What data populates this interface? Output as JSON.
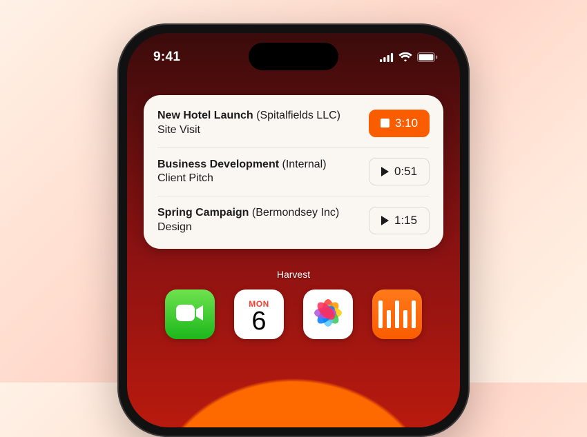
{
  "status": {
    "time": "9:41"
  },
  "widget": {
    "label": "Harvest",
    "entries": [
      {
        "project": "New Hotel Launch",
        "client": "(Spitalfields LLC)",
        "task": "Site Visit",
        "duration": "3:10",
        "active": true
      },
      {
        "project": "Business Development",
        "client": "(Internal)",
        "task": "Client Pitch",
        "duration": "0:51",
        "active": false
      },
      {
        "project": "Spring Campaign",
        "client": "(Bermondsey Inc)",
        "task": "Design",
        "duration": "1:15",
        "active": false
      }
    ]
  },
  "calendar": {
    "day": "MON",
    "date": "6"
  },
  "colors": {
    "accent": "#fa5c00"
  }
}
